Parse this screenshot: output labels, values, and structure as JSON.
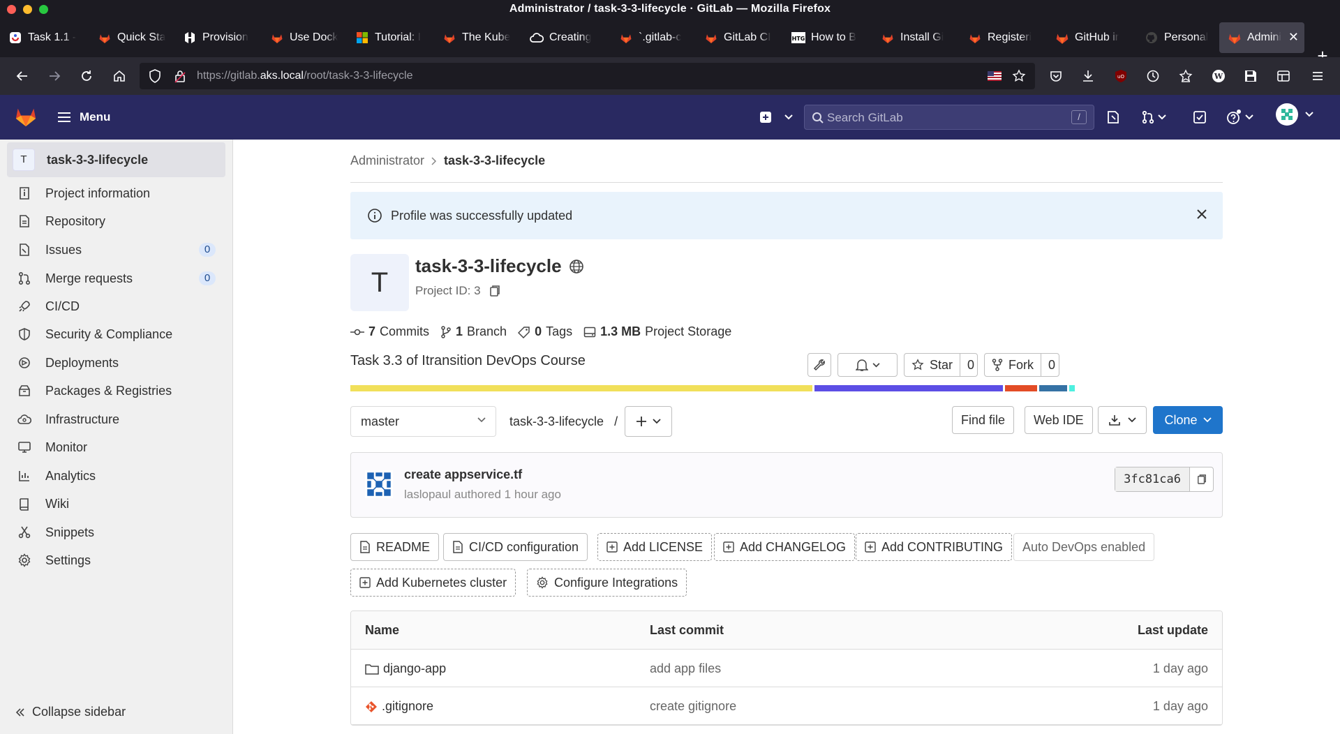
{
  "window": {
    "title": "Administrator / task-3-3-lifecycle · GitLab — Mozilla Firefox"
  },
  "tabs": [
    {
      "label": "Task 1.1 -",
      "icon": "itransition-icon"
    },
    {
      "label": "Quick Sta",
      "icon": "gitlab-icon"
    },
    {
      "label": "Provision",
      "icon": "hashicorp-icon"
    },
    {
      "label": "Use Dock",
      "icon": "gitlab-icon"
    },
    {
      "label": "Tutorial: I",
      "icon": "microsoft-icon"
    },
    {
      "label": "The Kube",
      "icon": "gitlab-icon"
    },
    {
      "label": "Creating",
      "icon": "cloud-icon"
    },
    {
      "label": "`.gitlab-c",
      "icon": "gitlab-icon"
    },
    {
      "label": "GitLab CI",
      "icon": "gitlab-icon"
    },
    {
      "label": "How to B",
      "icon": "htg-icon"
    },
    {
      "label": "Install Gi",
      "icon": "gitlab-icon"
    },
    {
      "label": "Registeri",
      "icon": "gitlab-icon"
    },
    {
      "label": "GitHub ir",
      "icon": "gitlab-icon"
    },
    {
      "label": "Personal",
      "icon": "github-icon"
    },
    {
      "label": "Admini",
      "icon": "gitlab-icon",
      "active": true
    }
  ],
  "urlbar": {
    "prefix": "https://gitlab.",
    "host": "aks.local",
    "path": "/root/task-3-3-lifecycle"
  },
  "topbar": {
    "menu_label": "Menu",
    "search_placeholder": "Search GitLab",
    "search_shortcut": "/"
  },
  "sidebar": {
    "project_avatar": "T",
    "project_name": "task-3-3-lifecycle",
    "items": [
      {
        "label": "Project information",
        "icon": "info-icon"
      },
      {
        "label": "Repository",
        "icon": "document-icon"
      },
      {
        "label": "Issues",
        "icon": "issues-icon",
        "count": "0"
      },
      {
        "label": "Merge requests",
        "icon": "merge-request-icon",
        "count": "0"
      },
      {
        "label": "CI/CD",
        "icon": "rocket-icon"
      },
      {
        "label": "Security & Compliance",
        "icon": "shield-icon"
      },
      {
        "label": "Deployments",
        "icon": "deployments-icon"
      },
      {
        "label": "Packages & Registries",
        "icon": "package-icon"
      },
      {
        "label": "Infrastructure",
        "icon": "cloud-gear-icon"
      },
      {
        "label": "Monitor",
        "icon": "monitor-icon"
      },
      {
        "label": "Analytics",
        "icon": "chart-icon"
      },
      {
        "label": "Wiki",
        "icon": "book-icon"
      },
      {
        "label": "Snippets",
        "icon": "snippet-icon"
      },
      {
        "label": "Settings",
        "icon": "gear-icon"
      }
    ],
    "collapse_label": "Collapse sidebar"
  },
  "breadcrumb": {
    "parent": "Administrator",
    "current": "task-3-3-lifecycle"
  },
  "alert": {
    "message": "Profile was successfully updated"
  },
  "project": {
    "avatar": "T",
    "name": "task-3-3-lifecycle",
    "id_label": "Project ID: 3",
    "star_label": "Star",
    "star_count": "0",
    "fork_label": "Fork",
    "fork_count": "0",
    "description": "Task 3.3 of Itransition DevOps Course"
  },
  "stats": {
    "commits_num": "7",
    "commits_label": "Commits",
    "branch_num": "1",
    "branch_label": "Branch",
    "tags_num": "0",
    "tags_label": "Tags",
    "storage_num": "1.3 MB",
    "storage_label": "Project Storage"
  },
  "language_bar": [
    {
      "color": "#f1e05a",
      "share": 0.535
    },
    {
      "color": "#5c4ee5",
      "share": 0.218
    },
    {
      "color": "#e34c26",
      "share": 0.037
    },
    {
      "color": "#3572a5",
      "share": 0.032
    },
    {
      "color": "#4ef0e0",
      "share": 0.007
    }
  ],
  "toolbar": {
    "branch": "master",
    "path": "task-3-3-lifecycle",
    "path_sep": "/",
    "find_file": "Find file",
    "web_ide": "Web IDE",
    "clone": "Clone"
  },
  "last_commit": {
    "title": "create appservice.tf",
    "meta": "laslopaul authored 1 hour ago",
    "sha": "3fc81ca6"
  },
  "quick_actions": [
    {
      "label": "README",
      "icon": "file-icon",
      "style": "solid"
    },
    {
      "label": "CI/CD configuration",
      "icon": "file-icon",
      "style": "solid"
    },
    {
      "label": "Add LICENSE",
      "icon": "plus-square-icon",
      "style": "dashed"
    },
    {
      "label": "Add CHANGELOG",
      "icon": "plus-square-icon",
      "style": "dashed"
    },
    {
      "label": "Add CONTRIBUTING",
      "icon": "plus-square-icon",
      "style": "dashed"
    },
    {
      "label": "Auto DevOps enabled",
      "icon": "",
      "style": "plain"
    },
    {
      "label": "Add Kubernetes cluster",
      "icon": "plus-square-icon",
      "style": "dashed"
    },
    {
      "label": "Configure Integrations",
      "icon": "gear-icon",
      "style": "dashed"
    }
  ],
  "file_table": {
    "headers": {
      "name": "Name",
      "last_commit": "Last commit",
      "last_update": "Last update"
    },
    "rows": [
      {
        "name": "django-app",
        "type": "folder",
        "commit": "add app files",
        "updated": "1 day ago"
      },
      {
        "name": ".gitignore",
        "type": "git-file",
        "commit": "create gitignore",
        "updated": "1 day ago"
      }
    ]
  },
  "colors": {
    "gitlab_nav": "#292961",
    "primary_button": "#1f75cb",
    "alert_bg": "#e9f3fc"
  }
}
